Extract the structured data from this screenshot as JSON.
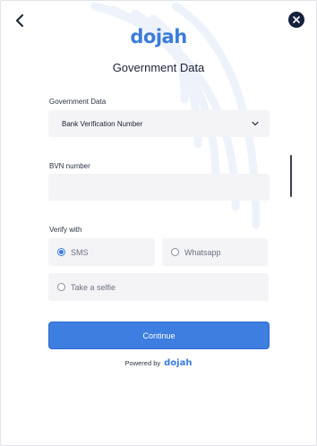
{
  "header": {
    "back_icon": "chevron-left-icon",
    "close_icon": "close-icon",
    "brand": "dojah",
    "title": "Government Data"
  },
  "form": {
    "gov_data": {
      "label": "Government Data",
      "selected": "Bank Verification Number",
      "icon": "chevron-down-icon"
    },
    "bvn": {
      "label": "BVN number",
      "value": "",
      "placeholder": ""
    },
    "verify_with": {
      "label": "Verify with",
      "options": [
        {
          "label": "SMS",
          "checked": true
        },
        {
          "label": "Whatsapp",
          "checked": false
        },
        {
          "label": "Take a selfie",
          "checked": false
        }
      ]
    }
  },
  "actions": {
    "continue_label": "Continue"
  },
  "footer": {
    "powered_by": "Powered by",
    "brand": "dojah"
  },
  "colors": {
    "accent": "#3d7ee0",
    "brand": "#3b7cdc",
    "close_bg": "#15203c",
    "field_bg": "#f4f4f6",
    "arc": "#eef3fb"
  }
}
